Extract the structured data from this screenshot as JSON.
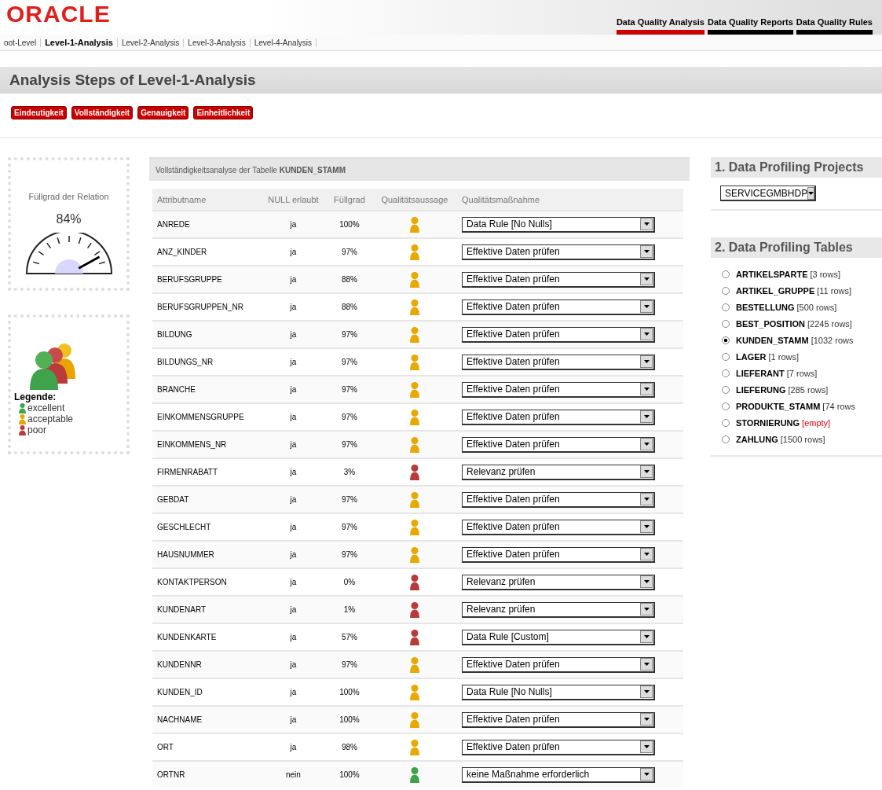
{
  "header": {
    "logo": "ORACLE",
    "nav": [
      {
        "label": "Data Quality Analysis",
        "selected": true
      },
      {
        "label": "Data Quality Reports",
        "selected": false
      },
      {
        "label": "Data Quality Rules",
        "selected": false
      }
    ]
  },
  "breadcrumb": [
    {
      "label": "oot-Level",
      "selected": false
    },
    {
      "label": "Level-1-Analysis",
      "selected": true
    },
    {
      "label": "Level-2-Analysis",
      "selected": false
    },
    {
      "label": "Level-3-Analysis",
      "selected": false
    },
    {
      "label": "Level-4-Analysis",
      "selected": false
    }
  ],
  "page_title": "Analysis Steps of Level-1-Analysis",
  "steps": [
    "Eindeutigkeit",
    "Vollständigkeit",
    "Genauigkeit",
    "Einheitlichkeit"
  ],
  "gauge": {
    "title": "Füllgrad der Relation",
    "value": "84%",
    "level": 0.84
  },
  "legend": {
    "title": "Legende:",
    "items": [
      {
        "label": "excellent",
        "color": "#3ea34a"
      },
      {
        "label": "acceptable",
        "color": "#e8a800"
      },
      {
        "label": "poor",
        "color": "#b83a3a"
      }
    ]
  },
  "table": {
    "title": "Vollständigkeitsanalyse der Tabelle **KUNDEN_STAMM**",
    "columns": [
      "Attributname",
      "NULL erlaubt",
      "Füllgrad",
      "Qualitätsaussage",
      "Qualitätsmaßnahme"
    ],
    "rows": [
      {
        "name": "ANREDE",
        "null": "ja",
        "fill": "100%",
        "color": "#e8a800",
        "action": "Data Rule [No Nulls]"
      },
      {
        "name": "ANZ_KINDER",
        "null": "ja",
        "fill": "97%",
        "color": "#e8a800",
        "action": "Effektive Daten prüfen"
      },
      {
        "name": "BERUFSGRUPPE",
        "null": "ja",
        "fill": "88%",
        "color": "#e8a800",
        "action": "Effektive Daten prüfen"
      },
      {
        "name": "BERUFSGRUPPEN_NR",
        "null": "ja",
        "fill": "88%",
        "color": "#e8a800",
        "action": "Effektive Daten prüfen"
      },
      {
        "name": "BILDUNG",
        "null": "ja",
        "fill": "97%",
        "color": "#e8a800",
        "action": "Effektive Daten prüfen"
      },
      {
        "name": "BILDUNGS_NR",
        "null": "ja",
        "fill": "97%",
        "color": "#e8a800",
        "action": "Effektive Daten prüfen"
      },
      {
        "name": "BRANCHE",
        "null": "ja",
        "fill": "97%",
        "color": "#e8a800",
        "action": "Effektive Daten prüfen"
      },
      {
        "name": "EINKOMMENSGRUPPE",
        "null": "ja",
        "fill": "97%",
        "color": "#e8a800",
        "action": "Effektive Daten prüfen"
      },
      {
        "name": "EINKOMMENS_NR",
        "null": "ja",
        "fill": "97%",
        "color": "#e8a800",
        "action": "Effektive Daten prüfen"
      },
      {
        "name": "FIRMENRABATT",
        "null": "ja",
        "fill": "3%",
        "color": "#b83a3a",
        "action": "Relevanz prüfen"
      },
      {
        "name": "GEBDAT",
        "null": "ja",
        "fill": "97%",
        "color": "#e8a800",
        "action": "Effektive Daten prüfen"
      },
      {
        "name": "GESCHLECHT",
        "null": "ja",
        "fill": "97%",
        "color": "#e8a800",
        "action": "Effektive Daten prüfen"
      },
      {
        "name": "HAUSNUMMER",
        "null": "ja",
        "fill": "97%",
        "color": "#e8a800",
        "action": "Effektive Daten prüfen"
      },
      {
        "name": "KONTAKTPERSON",
        "null": "ja",
        "fill": "0%",
        "color": "#b83a3a",
        "action": "Relevanz prüfen"
      },
      {
        "name": "KUNDENART",
        "null": "ja",
        "fill": "1%",
        "color": "#b83a3a",
        "action": "Relevanz prüfen"
      },
      {
        "name": "KUNDENKARTE",
        "null": "ja",
        "fill": "57%",
        "color": "#b83a3a",
        "action": "Data Rule [Custom]"
      },
      {
        "name": "KUNDENNR",
        "null": "ja",
        "fill": "97%",
        "color": "#e8a800",
        "action": "Effektive Daten prüfen"
      },
      {
        "name": "KUNDEN_ID",
        "null": "ja",
        "fill": "100%",
        "color": "#e8a800",
        "action": "Data Rule [No Nulls]"
      },
      {
        "name": "NACHNAME",
        "null": "ja",
        "fill": "100%",
        "color": "#e8a800",
        "action": "Effektive Daten prüfen"
      },
      {
        "name": "ORT",
        "null": "ja",
        "fill": "98%",
        "color": "#e8a800",
        "action": "Effektive Daten prüfen"
      },
      {
        "name": "ORTNR",
        "null": "nein",
        "fill": "100%",
        "color": "#3ea34a",
        "action": "keine Maßnahme erforderlich"
      }
    ]
  },
  "projects": {
    "title": "1. Data Profiling Projects",
    "value": "SERVICEGMBHDP"
  },
  "tables": {
    "title": "2. Data Profiling Tables",
    "items": [
      {
        "name": "ARTIKELSPARTE",
        "count": "[3 rows]",
        "selected": false,
        "empty": false
      },
      {
        "name": "ARTIKEL_GRUPPE",
        "count": "[11 rows]",
        "selected": false,
        "empty": false
      },
      {
        "name": "BESTELLUNG",
        "count": "[500 rows]",
        "selected": false,
        "empty": false
      },
      {
        "name": "BEST_POSITION",
        "count": "[2245 rows]",
        "selected": false,
        "empty": false
      },
      {
        "name": "KUNDEN_STAMM",
        "count": "[1032 rows",
        "selected": true,
        "empty": false
      },
      {
        "name": "LAGER",
        "count": "[1 rows]",
        "selected": false,
        "empty": false
      },
      {
        "name": "LIEFERANT",
        "count": "[7 rows]",
        "selected": false,
        "empty": false
      },
      {
        "name": "LIEFERUNG",
        "count": "[285 rows]",
        "selected": false,
        "empty": false
      },
      {
        "name": "PRODUKTE_STAMM",
        "count": "[74 rows",
        "selected": false,
        "empty": false
      },
      {
        "name": "STORNIERUNG",
        "count": "[empty]",
        "selected": false,
        "empty": true
      },
      {
        "name": "ZAHLUNG",
        "count": "[1500 rows]",
        "selected": false,
        "empty": false
      }
    ]
  }
}
